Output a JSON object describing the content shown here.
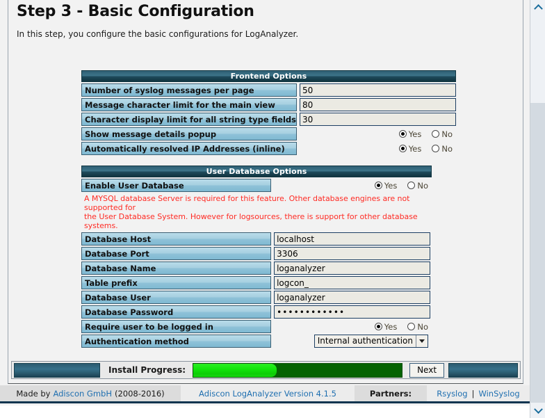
{
  "page": {
    "title": "Step 3 - Basic Configuration",
    "subtitle": "In this step, you configure the basic configurations for LogAnalyzer."
  },
  "frontend_options": {
    "section_title": "Frontend Options",
    "rows": [
      {
        "label": "Number of syslog messages per page",
        "type": "text",
        "value": "50"
      },
      {
        "label": "Message character limit for the main view",
        "type": "text",
        "value": "80"
      },
      {
        "label": "Character display limit for all string type fields",
        "type": "text",
        "value": "30"
      },
      {
        "label": "Show message details popup",
        "type": "radio",
        "selected": "Yes",
        "yes_label": "Yes",
        "no_label": "No"
      },
      {
        "label": "Automatically resolved IP Addresses (inline)",
        "type": "radio",
        "selected": "Yes",
        "yes_label": "Yes",
        "no_label": "No"
      }
    ]
  },
  "user_database_options": {
    "section_title": "User Database Options",
    "enable_row": {
      "label": "Enable User Database",
      "type": "radio",
      "selected": "Yes",
      "yes_label": "Yes",
      "no_label": "No"
    },
    "note_line1": "A MYSQL database Server is required for this feature. Other database engines are not supported for",
    "note_line2": "the User Database System. However for logsources, there is support for other database systems.",
    "rows": [
      {
        "label": "Database Host",
        "type": "text",
        "value": "localhost"
      },
      {
        "label": "Database Port",
        "type": "text",
        "value": "3306"
      },
      {
        "label": "Database Name",
        "type": "text",
        "value": "loganalyzer"
      },
      {
        "label": "Table prefix",
        "type": "text",
        "value": "logcon_"
      },
      {
        "label": "Database User",
        "type": "text",
        "value": "loganalyzer"
      },
      {
        "label": "Database Password",
        "type": "password",
        "value": "••••••••••••"
      },
      {
        "label": "Require user to be logged in",
        "type": "radio",
        "selected": "Yes",
        "yes_label": "Yes",
        "no_label": "No"
      },
      {
        "label": "Authentication method",
        "type": "select",
        "value": "Internal authentication"
      }
    ]
  },
  "progress": {
    "label": "Install Progress:",
    "percent": 40,
    "next_label": "Next",
    "fill_color": "#12e60b",
    "track_color": "#046302"
  },
  "credits": {
    "made_prefix": "Made by",
    "made_company": "Adiscon GmbH",
    "made_years": "(2008-2016)",
    "version": "Adiscon LogAnalyzer Version 4.1.5",
    "partners_label": "Partners:",
    "partner_links": [
      "Rsyslog",
      "WinSyslog"
    ],
    "link_separator": "|"
  },
  "scrollbar": {
    "up_icon": "chevron-up-icon",
    "down_icon": "chevron-down-icon"
  },
  "colors": {
    "section_header": "#2f5f74",
    "field_label": "#a6cfe0",
    "warning_text": "#ff2b24",
    "link": "#1f6fb0",
    "teal_bar": "#2b5b70"
  }
}
